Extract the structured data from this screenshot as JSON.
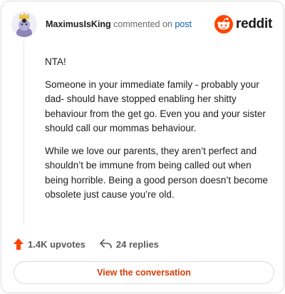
{
  "header": {
    "username": "MaximusIsKing",
    "action_text": "commented on",
    "post_link": "post",
    "logo_text": "reddit"
  },
  "comment": {
    "paragraphs": [
      "NTA!",
      "Someone in your immediate family - probably your dad- should have stopped enabling her shitty behaviour from the get go. Even you and your sister should call our mommas behaviour.",
      "While we love our parents, they aren’t perfect and shouldn’t be immune from being called out when being horrible. Being a good person doesn’t become obsolete just cause you’re old."
    ]
  },
  "footer": {
    "upvotes": "1.4K upvotes",
    "replies": "24 replies"
  },
  "cta_label": "View the conversation",
  "colors": {
    "brand": "#ff4500",
    "link": "#0f5fb3",
    "cta_text": "#d93a00"
  },
  "icons": [
    "avatar",
    "reddit-logo-icon",
    "upvote-arrow-icon",
    "reply-arrow-icon"
  ]
}
